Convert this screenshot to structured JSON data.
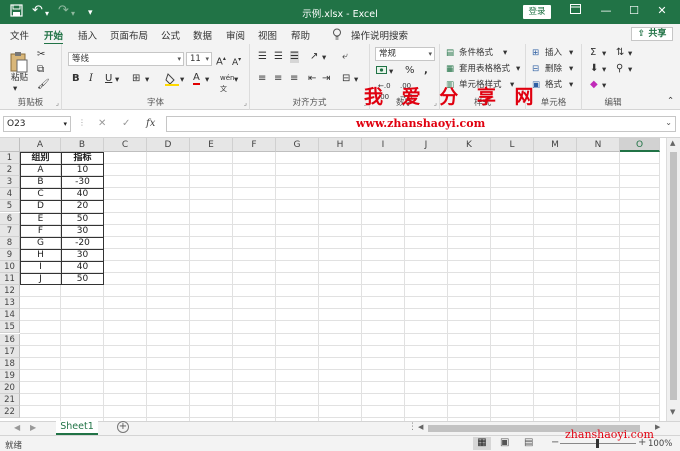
{
  "titlebar": {
    "autosave_icon": "save-icon",
    "undo_icon": "undo-icon",
    "redo_icon": "redo-icon",
    "customize_icon": "chevron-down-icon",
    "title": "示例.xlsx  -  Excel",
    "login_label": "登录",
    "ribbon_options_icon": "ribbon-display-icon",
    "minimize": "—",
    "maximize": "☐",
    "close": "✕",
    "accent": "#217346"
  },
  "menu": {
    "items": [
      "文件",
      "开始",
      "插入",
      "页面布局",
      "公式",
      "数据",
      "审阅",
      "视图",
      "帮助"
    ],
    "search_label": "操作说明搜索",
    "share_label": "共享"
  },
  "ribbon": {
    "clipboard": {
      "paste_label": "粘贴",
      "label": "剪贴板"
    },
    "font": {
      "name": "等线",
      "size": "11",
      "bold": "B",
      "italic": "I",
      "underline": "U",
      "label": "字体"
    },
    "alignment": {
      "label": "对齐方式"
    },
    "number": {
      "format": "常规",
      "percent": "%",
      "comma": ",",
      "label": "数字"
    },
    "styles": {
      "conditional": "条件格式",
      "table": "套用表格格式",
      "cell_styles": "单元格样式",
      "label": "样式"
    },
    "cells": {
      "insert": "插入",
      "delete": "删除",
      "format": "格式",
      "label": "单元格"
    },
    "editing": {
      "label": "编辑"
    }
  },
  "watermark": {
    "title": "我 爱 分 享 网",
    "url": "www.zhanshaoyi.com",
    "url_bottom": "zhanshaoyi.com"
  },
  "formula_bar": {
    "name_box": "O23",
    "cancel": "✕",
    "enter": "✓",
    "fx": "fx",
    "value": ""
  },
  "grid": {
    "columns": [
      "A",
      "B",
      "C",
      "D",
      "E",
      "F",
      "G",
      "H",
      "I",
      "J",
      "K",
      "L",
      "M",
      "N",
      "O"
    ],
    "selected_column": "O",
    "rows": [
      "1",
      "2",
      "3",
      "4",
      "5",
      "6",
      "7",
      "8",
      "9",
      "10",
      "11",
      "12",
      "13",
      "14",
      "15",
      "16",
      "17",
      "18",
      "19",
      "20",
      "21",
      "22"
    ],
    "header": [
      "组别",
      "指标"
    ],
    "data": [
      [
        "A",
        "10"
      ],
      [
        "B",
        "-30"
      ],
      [
        "C",
        "40"
      ],
      [
        "D",
        "20"
      ],
      [
        "E",
        "50"
      ],
      [
        "F",
        "30"
      ],
      [
        "G",
        "-20"
      ],
      [
        "H",
        "30"
      ],
      [
        "I",
        "40"
      ],
      [
        "J",
        "50"
      ]
    ]
  },
  "sheets": {
    "tabs": [
      "Sheet1"
    ],
    "add": "+"
  },
  "status": {
    "ready": "就绪",
    "zoom": "100%",
    "minus": "−",
    "plus": "+"
  }
}
